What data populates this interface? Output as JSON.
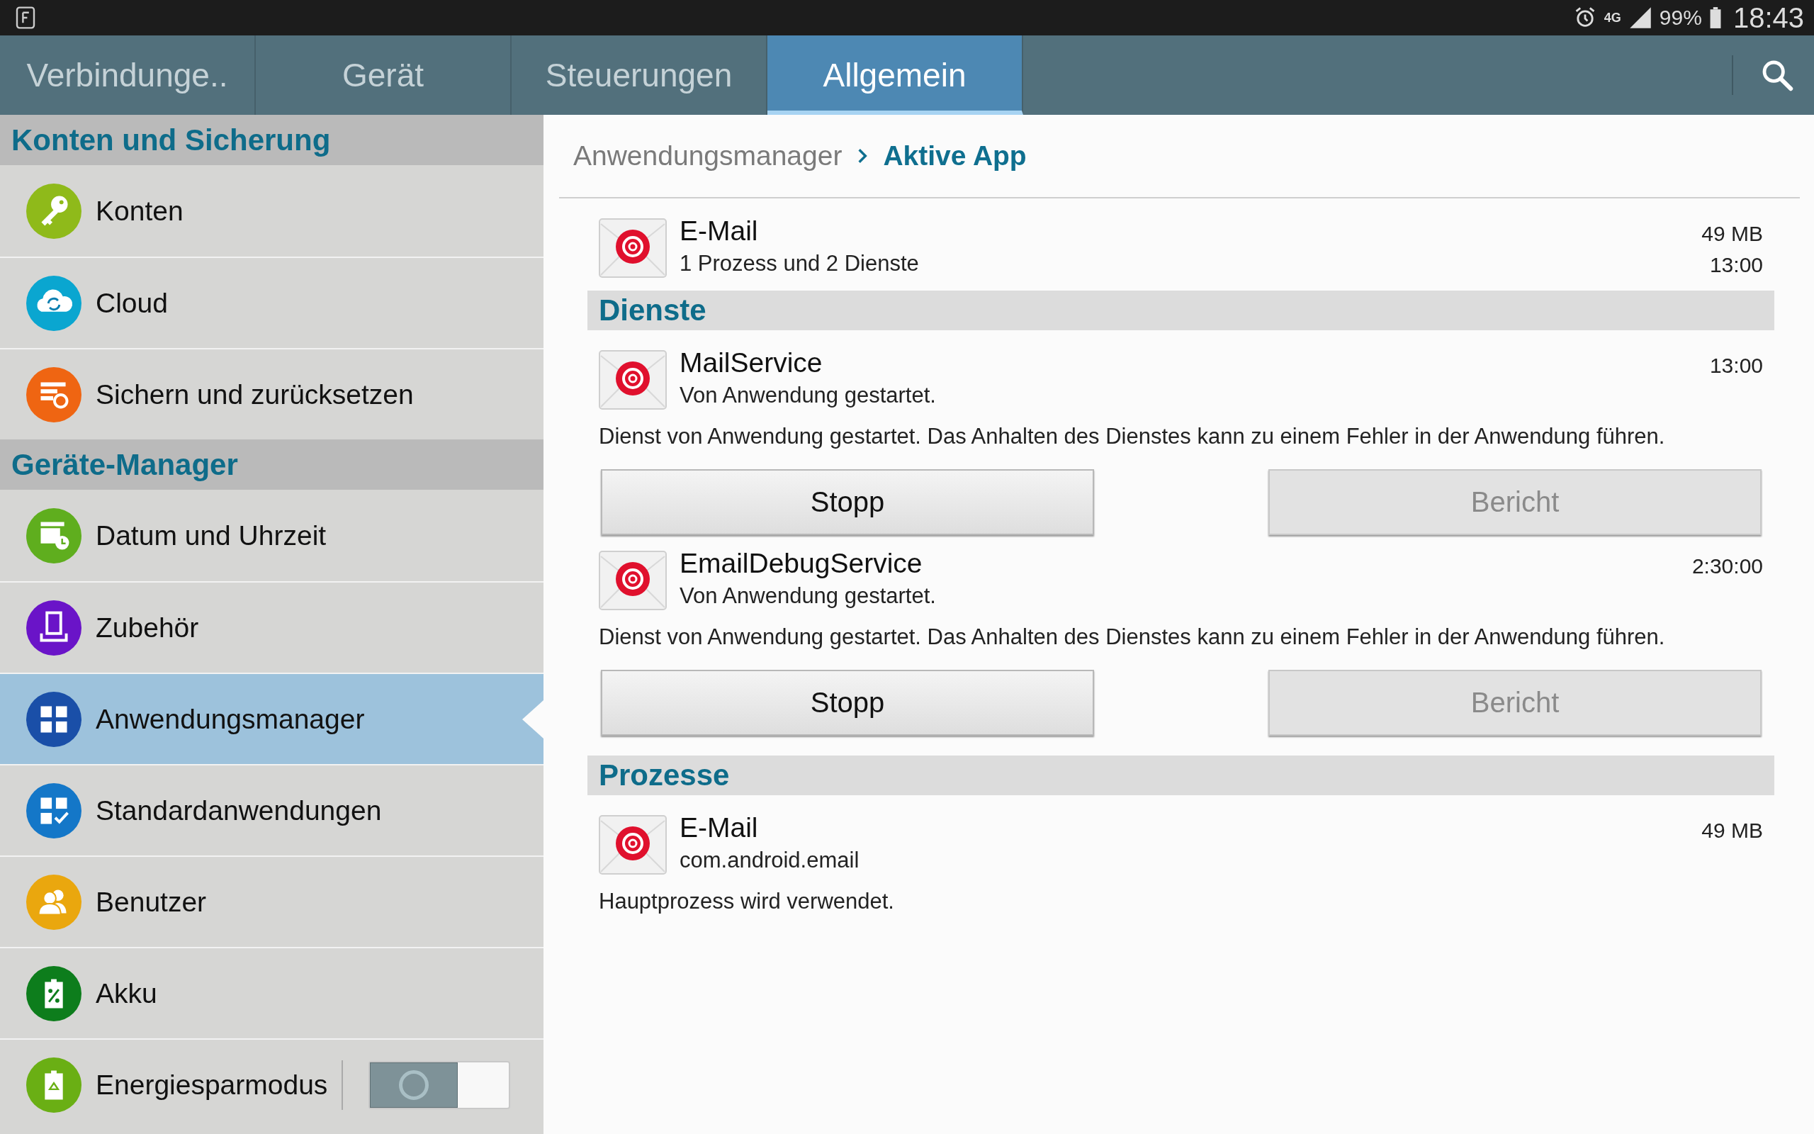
{
  "status_bar": {
    "network": "4G",
    "battery": "99%",
    "time": "18:43"
  },
  "tabs": [
    {
      "label": "Verbindunge..",
      "selected": false
    },
    {
      "label": "Gerät",
      "selected": false
    },
    {
      "label": "Steuerungen",
      "selected": false
    },
    {
      "label": "Allgemein",
      "selected": true
    }
  ],
  "sidebar": {
    "sections": [
      {
        "title": "Konten und Sicherung",
        "items": [
          {
            "label": "Konten",
            "kind": "key",
            "color": "#8fba1a",
            "selected": false
          },
          {
            "label": "Cloud",
            "kind": "cloud",
            "color": "#0aa6d0",
            "selected": false
          },
          {
            "label": "Sichern und zurücksetzen",
            "kind": "backup",
            "color": "#ef6512",
            "selected": false
          }
        ]
      },
      {
        "title": "Geräte-Manager",
        "items": [
          {
            "label": "Datum und Uhrzeit",
            "kind": "calendar",
            "color": "#5fae1e",
            "selected": false
          },
          {
            "label": "Zubehör",
            "kind": "accessory",
            "color": "#6a14c8",
            "selected": false
          },
          {
            "label": "Anwendungsmanager",
            "kind": "grid",
            "color": "#1a4fa8",
            "selected": true
          },
          {
            "label": "Standardanwendungen",
            "kind": "grid-check",
            "color": "#1477c8",
            "selected": false
          },
          {
            "label": "Benutzer",
            "kind": "users",
            "color": "#eaa70e",
            "selected": false
          },
          {
            "label": "Akku",
            "kind": "battery",
            "color": "#0d7d1c",
            "selected": false
          },
          {
            "label": "Energiesparmodus",
            "kind": "battery-recycle",
            "color": "#6aaf14",
            "selected": false,
            "toggle": {
              "on": false
            }
          }
        ]
      }
    ]
  },
  "breadcrumb": [
    {
      "label": "Anwendungsmanager",
      "current": false
    },
    {
      "label": "Aktive App",
      "current": true
    }
  ],
  "app": {
    "name": "E-Mail",
    "subtitle": "1 Prozess und 2 Dienste",
    "meta": [
      "49 MB",
      "13:00"
    ]
  },
  "sections": [
    {
      "title": "Dienste",
      "entries": [
        {
          "name": "MailService",
          "subtitle": "Von Anwendung gestartet.",
          "meta": [
            "13:00"
          ],
          "description": "Dienst von Anwendung gestartet. Das Anhalten des Dienstes kann zu einem Fehler in der Anwendung führen.",
          "buttons": [
            {
              "label": "Stopp",
              "disabled": false
            },
            {
              "label": "Bericht",
              "disabled": true
            }
          ]
        },
        {
          "name": "EmailDebugService",
          "subtitle": "Von Anwendung gestartet.",
          "meta": [
            "2:30:00"
          ],
          "description": "Dienst von Anwendung gestartet. Das Anhalten des Dienstes kann zu einem Fehler in der Anwendung führen.",
          "buttons": [
            {
              "label": "Stopp",
              "disabled": false
            },
            {
              "label": "Bericht",
              "disabled": true
            }
          ]
        }
      ]
    },
    {
      "title": "Prozesse",
      "entries": [
        {
          "name": "E-Mail",
          "subtitle": "com.android.email",
          "meta": [
            "49 MB"
          ],
          "description": "Hauptprozess wird verwendet."
        }
      ]
    }
  ]
}
